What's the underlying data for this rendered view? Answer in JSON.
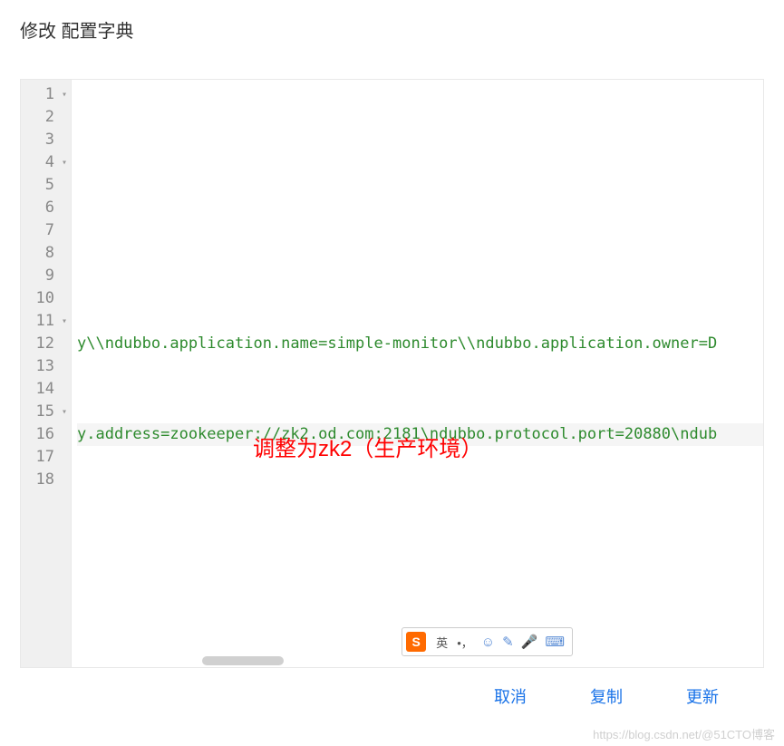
{
  "dialog": {
    "title": "修改 配置字典"
  },
  "editor": {
    "lines": [
      {
        "n": 1,
        "fold": true,
        "text": ""
      },
      {
        "n": 2,
        "fold": false,
        "text": ""
      },
      {
        "n": 3,
        "fold": false,
        "text": ""
      },
      {
        "n": 4,
        "fold": true,
        "text": ""
      },
      {
        "n": 5,
        "fold": false,
        "text": ""
      },
      {
        "n": 6,
        "fold": false,
        "text": ""
      },
      {
        "n": 7,
        "fold": false,
        "text": ""
      },
      {
        "n": 8,
        "fold": false,
        "text": ""
      },
      {
        "n": 9,
        "fold": false,
        "text": ""
      },
      {
        "n": 10,
        "fold": false,
        "text": ""
      },
      {
        "n": 11,
        "fold": true,
        "text": ""
      },
      {
        "n": 12,
        "fold": false,
        "text": "y\\\\ndubbo.application.name=simple-monitor\\\\ndubbo.application.owner=D"
      },
      {
        "n": 13,
        "fold": false,
        "text": ""
      },
      {
        "n": 14,
        "fold": false,
        "text": ""
      },
      {
        "n": 15,
        "fold": true,
        "text": ""
      },
      {
        "n": 16,
        "fold": false,
        "text": "y.address=zookeeper://zk2.od.com:2181\\ndubbo.protocol.port=20880\\ndub",
        "hl": true
      },
      {
        "n": 17,
        "fold": false,
        "text": ""
      },
      {
        "n": 18,
        "fold": false,
        "text": ""
      }
    ]
  },
  "annotation": {
    "text": "调整为zk2（生产环境）"
  },
  "ime": {
    "logo": "S",
    "lang": "英",
    "punct": "•，"
  },
  "footer": {
    "cancel": "取消",
    "copy": "复制",
    "update": "更新"
  },
  "watermark": "https://blog.csdn.net/@51CTO博客"
}
